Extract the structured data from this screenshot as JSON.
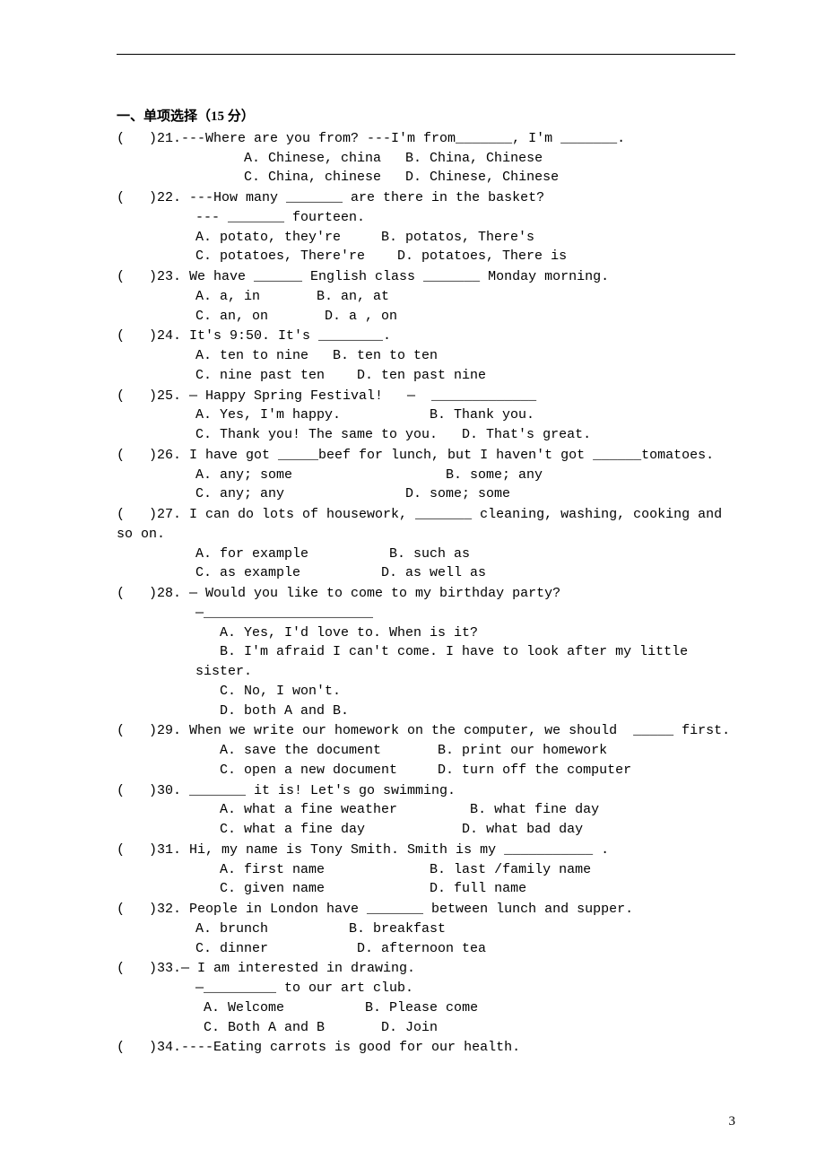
{
  "page_number": "3",
  "section_title": "一、单项选择（15 分）",
  "questions": [
    {
      "num": "21",
      "stem": "(   )21.---Where are you from? ---I'm from_______, I'm _______.",
      "choices": [
        "      A. Chinese, china   B. China, Chinese",
        "      C. China, chinese   D. Chinese, Chinese"
      ]
    },
    {
      "num": "22",
      "stem": "(   )22. ---How many _______ are there in the basket?",
      "continue": "--- _______ fourteen.",
      "choices": [
        "A. potato, they're     B. potatos, There's",
        "C. potatoes, There're    D. potatoes, There is"
      ]
    },
    {
      "num": "23",
      "stem": "(   )23. We have ______ English class _______ Monday morning.",
      "choices": [
        "A. a, in       B. an, at",
        "C. an, on       D. a , on"
      ]
    },
    {
      "num": "24",
      "stem": "(   )24. It's 9:50. It's ________.",
      "choices": [
        "A. ten to nine   B. ten to ten",
        "C. nine past ten    D. ten past nine"
      ]
    },
    {
      "num": "25",
      "stem": "(   )25. — Happy Spring Festival!   —  _____________",
      "choices": [
        "A. Yes, I'm happy.           B. Thank you.",
        "C. Thank you! The same to you.   D. That's great."
      ]
    },
    {
      "num": "26",
      "stem": "(   )26. I have got _____beef for lunch, but I haven't got ______tomatoes.",
      "choices": [
        "A. any; some                   B. some; any",
        "C. any; any               D. some; some"
      ]
    },
    {
      "num": "27",
      "stem": "(   )27. I can do lots of housework, _______ cleaning, washing, cooking and so on.",
      "choices": [
        "A. for example          B. such as",
        "C. as example          D. as well as"
      ]
    },
    {
      "num": "28",
      "stem": "(   )28. — Would you like to come to my birthday party?",
      "continue": "—_____________________",
      "choices": [
        "   A. Yes, I'd love to. When is it?",
        "   B. I'm afraid I can't come. I have to look after my little sister.",
        "   C. No, I won't.",
        "   D. both A and B."
      ]
    },
    {
      "num": "29",
      "stem": "(   )29. When we write our homework on the computer, we should  _____ first.",
      "choices": [
        "   A. save the document       B. print our homework",
        "   C. open a new document     D. turn off the computer"
      ]
    },
    {
      "num": "30",
      "stem": "(   )30. _______ it is! Let's go swimming.",
      "choices": [
        "   A. what a fine weather         B. what fine day",
        "   C. what a fine day            D. what bad day"
      ]
    },
    {
      "num": "31",
      "stem": "(   )31. Hi, my name is Tony Smith. Smith is my ___________ .",
      "choices": [
        "   A. first name             B. last /family name",
        "   C. given name             D. full name"
      ]
    },
    {
      "num": "32",
      "stem": "(   )32. People in London have _______ between lunch and supper.",
      "choices": [
        "A. brunch          B. breakfast",
        "C. dinner           D. afternoon tea"
      ]
    },
    {
      "num": "33",
      "stem": "(   )33.— I am interested in drawing.",
      "continue": "—_________ to our art club.",
      "choices": [
        " A. Welcome          B. Please come",
        " C. Both A and B       D. Join"
      ]
    },
    {
      "num": "34",
      "stem": "(   )34.----Eating carrots is good for our health."
    }
  ]
}
